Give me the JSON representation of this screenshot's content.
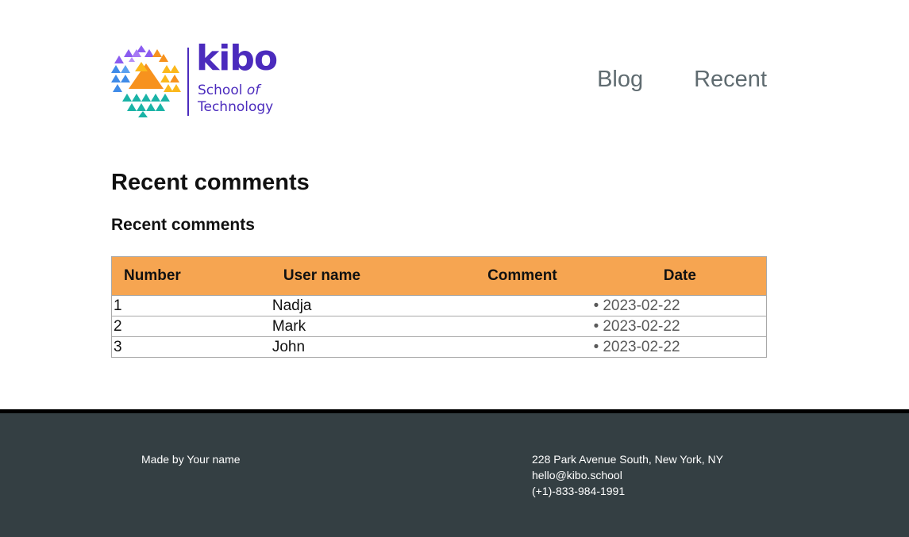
{
  "logo": {
    "word": "kibo",
    "sub_line1_prefix": "School ",
    "sub_line1_italic": "of",
    "sub_line2": "Technology",
    "colors": {
      "purple": "#4b2bbd",
      "orange": "#f7921e",
      "yellow": "#fbb81c",
      "blue": "#3f8be8",
      "violet": "#8b5cf0",
      "teal": "#1ab3a6"
    }
  },
  "nav": {
    "items": [
      "Blog",
      "Recent"
    ]
  },
  "main": {
    "title": "Recent comments",
    "subtitle": "Recent comments",
    "table": {
      "headers": [
        "Number",
        "User name",
        "Comment",
        "Date"
      ],
      "rows": [
        {
          "number": "1",
          "user": "Nadja",
          "comment": "",
          "date": "2023-02-22"
        },
        {
          "number": "2",
          "user": "Mark",
          "comment": "",
          "date": "2023-02-22"
        },
        {
          "number": "3",
          "user": "John",
          "comment": "",
          "date": "2023-02-22"
        }
      ],
      "header_bg": "#f6a551"
    }
  },
  "footer": {
    "made_by": "Made by Your name",
    "address": "228 Park Avenue South, New York, NY",
    "email": "hello@kibo.school",
    "phone": "(+1)-833-984-1991",
    "bg": "#343f43"
  }
}
